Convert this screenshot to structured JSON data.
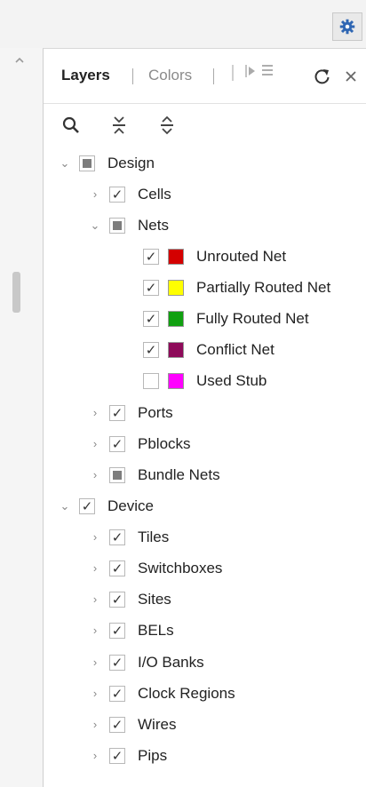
{
  "panel": {
    "tabs": {
      "active": "Layers",
      "inactive": "Colors"
    }
  },
  "tree": {
    "design": {
      "label": "Design",
      "cells": "Cells",
      "nets": {
        "label": "Nets",
        "items": [
          {
            "label": "Unrouted Net",
            "color": "#d40000",
            "checked": true
          },
          {
            "label": "Partially Routed Net",
            "color": "#ffff00",
            "checked": true
          },
          {
            "label": "Fully Routed Net",
            "color": "#10a010",
            "checked": true
          },
          {
            "label": "Conflict Net",
            "color": "#8e0a5a",
            "checked": true
          },
          {
            "label": "Used Stub",
            "color": "#ff00ff",
            "checked": false
          }
        ]
      },
      "ports": "Ports",
      "pblocks": "Pblocks",
      "bundle_nets": "Bundle Nets"
    },
    "device": {
      "label": "Device",
      "items": [
        "Tiles",
        "Switchboxes",
        "Sites",
        "BELs",
        "I/O Banks",
        "Clock Regions",
        "Wires",
        "Pips"
      ]
    }
  },
  "icons": {
    "settings": "gear-icon",
    "search": "search-icon",
    "collapse_all": "collapse-all-icon",
    "expand_all": "expand-all-icon",
    "refresh": "refresh-icon",
    "close": "close-icon"
  }
}
